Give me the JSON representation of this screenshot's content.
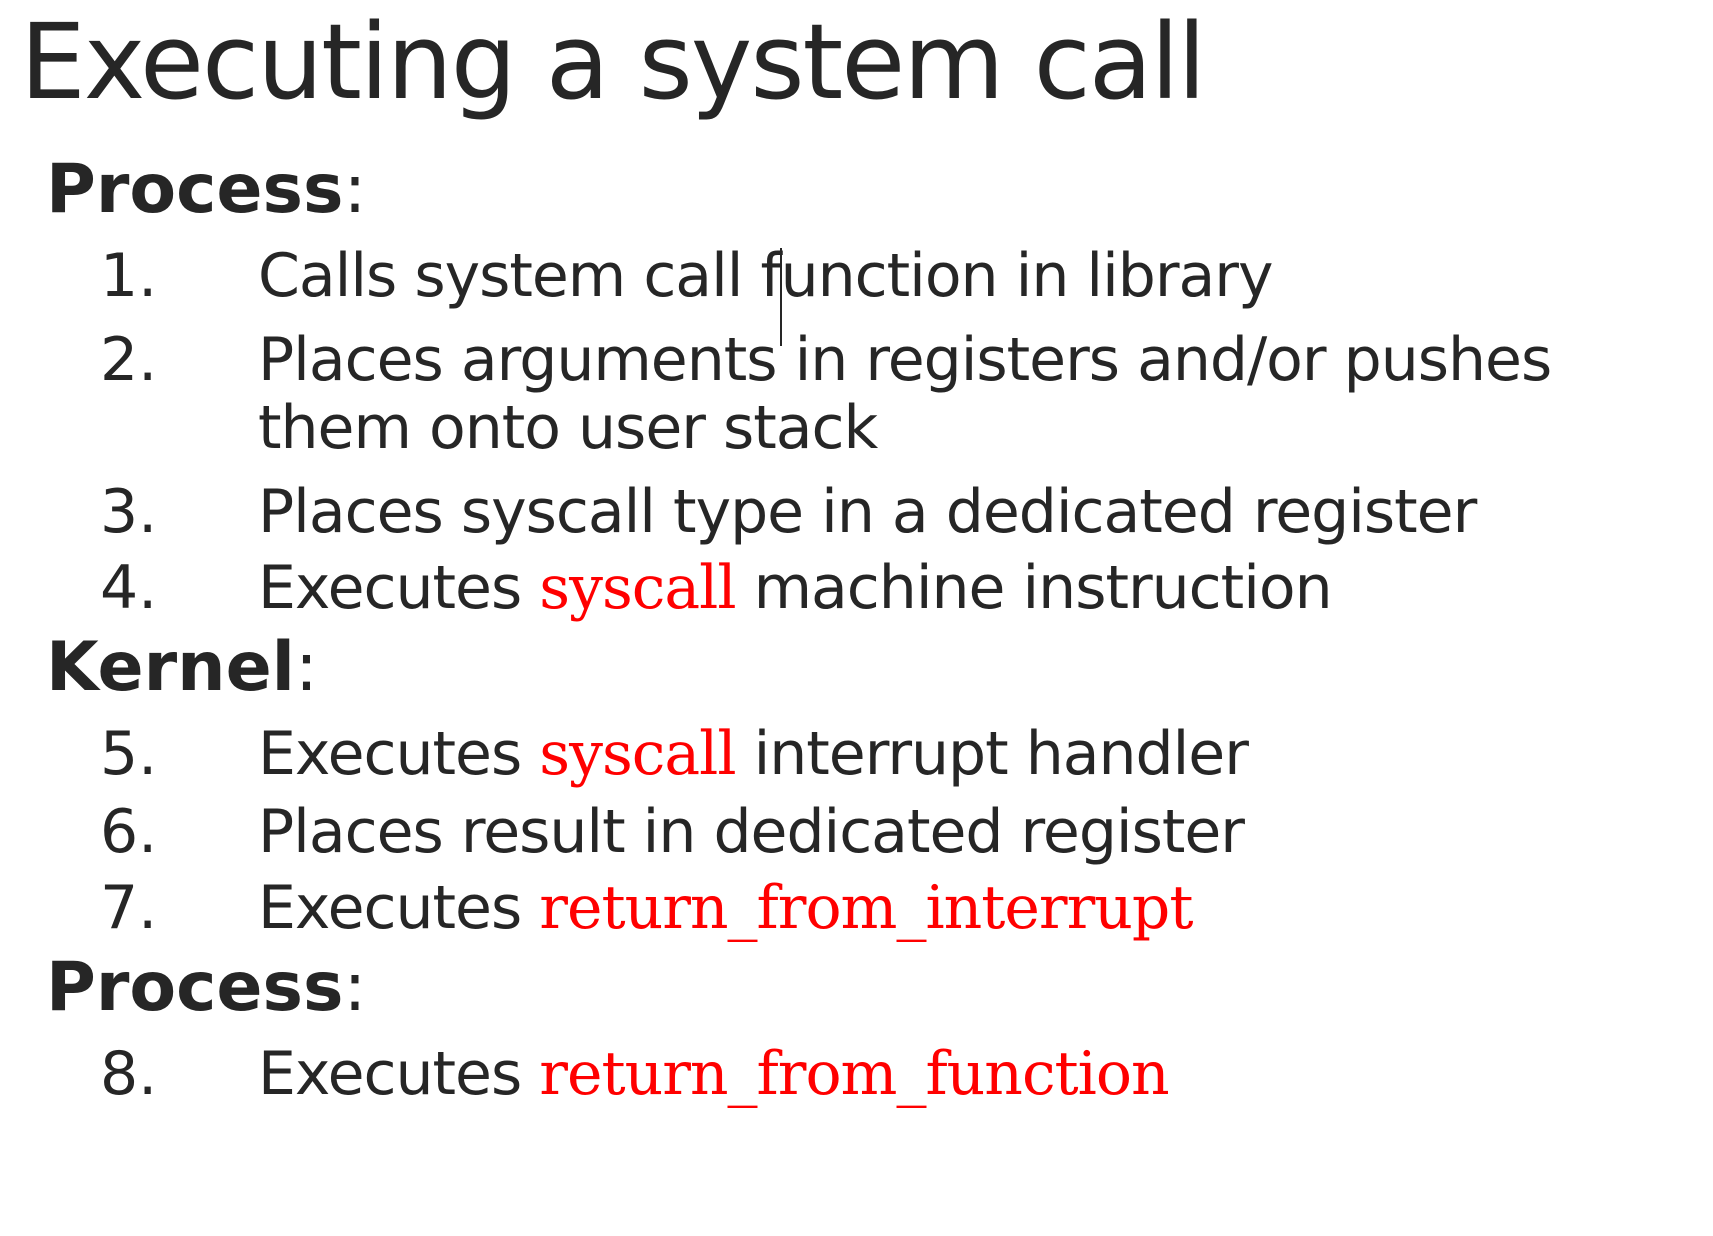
{
  "title": "Executing a system call",
  "sections": [
    {
      "heading": "Process",
      "colon": ":"
    },
    {
      "heading": "Kernel",
      "colon": ":"
    },
    {
      "heading": "Process",
      "colon": ":"
    }
  ],
  "steps": [
    {
      "num": "1.",
      "text": "Calls system call function in library"
    },
    {
      "num": "2.",
      "line1": "Places arguments in registers and/or pushes",
      "line2": "them onto user stack"
    },
    {
      "num": "3.",
      "text": "Places syscall type in a dedicated register"
    },
    {
      "num": "4.",
      "pre": "Executes ",
      "code": "syscall",
      "post": " machine instruction"
    },
    {
      "num": "5.",
      "pre": "Executes ",
      "code": "syscall",
      "post": " interrupt handler"
    },
    {
      "num": "6.",
      "text": "Places result in dedicated register"
    },
    {
      "num": "7.",
      "pre": "Executes ",
      "code": "return_from_interrupt"
    },
    {
      "num": "8.",
      "pre": "Executes ",
      "code": "return_from_function"
    }
  ],
  "colors": {
    "text": "#262626",
    "code": "#ff0000",
    "background": "#ffffff"
  }
}
